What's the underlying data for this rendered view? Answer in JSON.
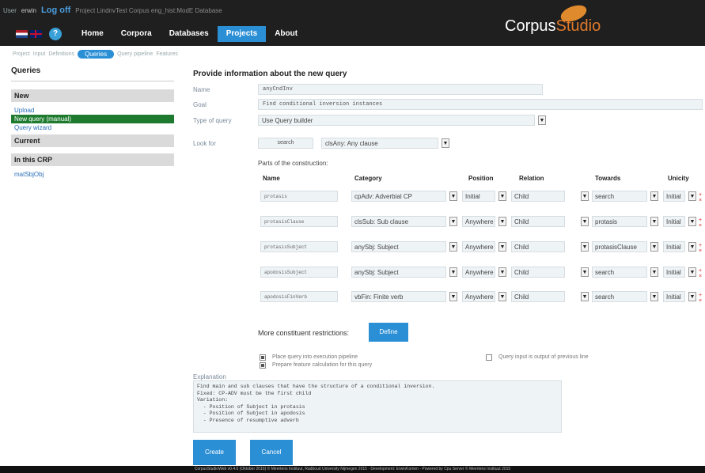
{
  "header": {
    "user_label": "User",
    "user_name": "erwin",
    "logoff": "Log off",
    "crumbs": "Project  LindnvTest  Corpus  eng_hist:ModE  Database",
    "nav": [
      "Home",
      "Corpora",
      "Databases",
      "Projects",
      "About"
    ],
    "active_nav": "Projects",
    "brand_corpus": "Corpus",
    "brand_studio": "Studio",
    "help_glyph": "?"
  },
  "subnav": {
    "items": [
      "Project",
      "Input",
      "Definitions",
      "Queries",
      "Query pipeline",
      "Features"
    ],
    "active": "Queries"
  },
  "sidebar": {
    "title": "Queries",
    "new_section": "New",
    "new_items": [
      "Upload",
      "New query (manual)",
      "Query wizard"
    ],
    "active_item": "New query (manual)",
    "current_section": "Current",
    "crp_section": "In this CRP",
    "crp_items": [
      "matSbjObj"
    ]
  },
  "form": {
    "title": "Provide information about the new query",
    "name_label": "Name",
    "name_value": "anyCndInv",
    "goal_label": "Goal",
    "goal_value": "Find conditional inversion instances",
    "type_label": "Type of query",
    "type_value": "Use Query builder",
    "lookfor_label": "Look for",
    "lookfor_name": "search",
    "lookfor_category": "clsAny: Any clause",
    "parts_label": "Parts of the construction:",
    "columns": [
      "Name",
      "Category",
      "Position",
      "Relation",
      "Towards",
      "Unicity"
    ],
    "rows": [
      {
        "name": "protasis",
        "category": "cpAdv: Adverbial CP",
        "position": "Initial",
        "relation": "Child",
        "towards": "search",
        "unicity": "Initial"
      },
      {
        "name": "protasisClause",
        "category": "clsSub: Sub clause",
        "position": "Anywhere",
        "relation": "Child",
        "towards": "protasis",
        "unicity": "Initial"
      },
      {
        "name": "protasisSubject",
        "category": "anySbj: Subject",
        "position": "Anywhere",
        "relation": "Child",
        "towards": "protasisClause",
        "unicity": "Initial"
      },
      {
        "name": "apodosisSubject",
        "category": "anySbj: Subject",
        "position": "Anywhere",
        "relation": "Child",
        "towards": "search",
        "unicity": "Initial"
      },
      {
        "name": "apodosisFinVerb",
        "category": "vbFin: Finite verb",
        "position": "Anywhere",
        "relation": "Child",
        "towards": "search",
        "unicity": "Initial"
      }
    ],
    "row_marker": "+ ×",
    "constraints_label": "More constituent restrictions:",
    "define_label": "Define",
    "cb_pipeline": "Place query into execution pipeline",
    "cb_features": "Prepare feature calculation for this query",
    "cb_output": "Query input is output of previous line",
    "explanation_label": "Explanation",
    "explanation_text": "Find main and sub clauses that have the structure of a conditional inversion.\nFixed: CP-ADV must be the first child\nVariation:\n  - Position of Subject in protasis\n  - Position of Subject in apodosis\n  - Presence of resumptive adverb",
    "create_label": "Create",
    "cancel_label": "Cancel"
  },
  "footer": {
    "text": "CorpusStudioWeb v0.4.6 (Oktober 2016) © Meertens Instituut, Radboud University Nijmegen 2015 - Development: ErwinKomen - Powered by Cpu Server © Meertens Instituut 2015"
  },
  "colors": {
    "accent": "#2b8fd6",
    "topbar": "#1f1f1f",
    "active_green": "#1e7a2e",
    "brand_orange": "#e07a2b"
  }
}
